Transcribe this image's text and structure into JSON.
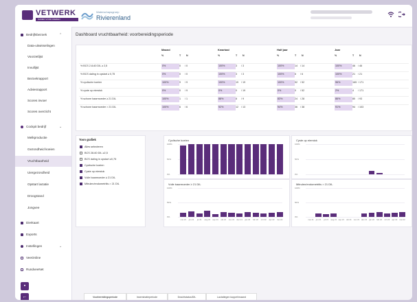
{
  "header": {
    "logo_text": "VETWERK",
    "logo_sub": "SAMEN VOOR DIEREN",
    "partner_small": "Waterschapsgroep",
    "partner_big": "Rivierenland",
    "wifi_icon": "wifi-icon",
    "logout_icon": "logout-icon"
  },
  "sidebar": {
    "items": [
      {
        "label": "Bedrijfsbezoek",
        "chevron": "⌃"
      },
      {
        "label": "Data-uitwisselingen"
      },
      {
        "label": "Voorzetlijst"
      },
      {
        "label": "Invullijst"
      },
      {
        "label": "Bezoekrapport"
      },
      {
        "label": "Adviesrapport"
      },
      {
        "label": "Scores invoer"
      },
      {
        "label": "Scores overzicht"
      },
      {
        "label": "Cockpit bedrijf",
        "chevron": "⌄"
      },
      {
        "label": "Melkproductie"
      },
      {
        "label": "Gezondheid koeien"
      },
      {
        "label": "Vruchtbaarheid"
      },
      {
        "label": "Uiergezondheid"
      },
      {
        "label": "Opstart lactatie"
      },
      {
        "label": "Droogstand"
      },
      {
        "label": "Jongvee"
      },
      {
        "label": "Dierkaart"
      },
      {
        "label": "Exports"
      },
      {
        "label": "Instellingen",
        "chevron": "⌄"
      },
      {
        "label": "VeeOnline"
      },
      {
        "label": "RundveeNet"
      }
    ]
  },
  "main": {
    "title": "Dashboard vruchtbaarheid: voorbereidingsperiode",
    "groups": [
      "Maand",
      "Kwartaal",
      "Half jaar",
      "Jaar"
    ],
    "col_headers": [
      "%",
      "T",
      "N"
    ],
    "rows": [
      {
        "label": "% BCS 2.8-60 DIL ≥ 2,5",
        "cells": [
          [
            "0%",
            "0",
            "/ 0"
          ],
          [
            "100%",
            "3",
            "/ 3"
          ],
          [
            "100%",
            "14",
            "/ 14"
          ],
          [
            "100%",
            "46",
            "/ 46"
          ]
        ]
      },
      {
        "label": "% BCS daling in opstart ≥ 0,75",
        "cells": [
          [
            "0%",
            "0",
            "/ 0"
          ],
          [
            "100%",
            "3",
            "/ 3"
          ],
          [
            "100%",
            "6",
            "/ 6"
          ],
          [
            "100%",
            "21",
            "/ 21"
          ]
        ]
      },
      {
        "label": "% cyclische koeien",
        "cells": [
          [
            "100%",
            "9",
            "/ 9"
          ],
          [
            "100%",
            "19",
            "/ 19"
          ],
          [
            "100%",
            "52",
            "/ 52"
          ],
          [
            "96%",
            "165",
            "/ 171"
          ]
        ]
      },
      {
        "label": "% cyste op eierstok",
        "cells": [
          [
            "0%",
            "0",
            "/ 9"
          ],
          [
            "0%",
            "0",
            "/ 19"
          ],
          [
            "0%",
            "0",
            "/ 52"
          ],
          [
            "2%",
            "4",
            "/ 171"
          ]
        ]
      },
      {
        "label": "% schone baarmoeder ≥ 21 DIL",
        "cells": [
          [
            "100%",
            "1",
            "/ 1"
          ],
          [
            "88%",
            "8",
            "/ 9"
          ],
          [
            "83%",
            "24",
            "/ 28"
          ],
          [
            "86%",
            "80",
            "/ 93"
          ]
        ]
      },
      {
        "label": "% schone baarmoeder > 21 DIL",
        "cells": [
          [
            "100%",
            "6",
            "/ 6"
          ],
          [
            "92%",
            "12",
            "/ 13"
          ],
          [
            "94%",
            "36",
            "/ 38"
          ],
          [
            "91%",
            "94",
            "/ 103"
          ]
        ]
      }
    ]
  },
  "toon": {
    "title": "Toon grafiek",
    "options": [
      {
        "label": "Alles selecteren",
        "checked": true
      },
      {
        "label": "BCS 28-60 DIL ≥2,5",
        "checked": false
      },
      {
        "label": "BCS daling in opstart ≥0,75",
        "checked": false
      },
      {
        "label": "Cyclische koeien",
        "checked": true
      },
      {
        "label": "Cyste op eierstok",
        "checked": true
      },
      {
        "label": "Vuile baarmoeder ≥ 21 DIL",
        "checked": true
      },
      {
        "label": "Mitrulen/endometritis > 21 DIL",
        "checked": true
      }
    ]
  },
  "charts": {
    "months": [
      "mei 21",
      "jun 21",
      "jul 21",
      "aug 21",
      "sep 21",
      "okt 21",
      "nov 21",
      "dec 21",
      "jan 22",
      "feb 22",
      "mrt 22",
      "apr 22",
      "mei 22"
    ],
    "yticks": [
      "100%",
      "50%",
      "0%"
    ],
    "c1": {
      "title": "Cyclische koeien",
      "values": [
        96,
        100,
        100,
        100,
        100,
        100,
        100,
        100,
        100,
        100,
        100,
        100,
        100
      ]
    },
    "c2": {
      "title": "Cyste op eierstok",
      "values": [
        0,
        0,
        0,
        0,
        0,
        0,
        0,
        0,
        12,
        4,
        0,
        0,
        0
      ]
    },
    "c3": {
      "title": "Vuile baarmoeder ≥ 21 DIL",
      "values": [
        14,
        20,
        12,
        22,
        10,
        16,
        14,
        12,
        16,
        14,
        12,
        14,
        16
      ]
    },
    "c4": {
      "title": "Mitrulen/endometritis > 21 DIL",
      "values": [
        0,
        12,
        10,
        12,
        0,
        0,
        0,
        12,
        14,
        16,
        12,
        14,
        16
      ]
    }
  },
  "tabs": [
    "Voorbereidingsperiode",
    "Inseminatieperiode",
    "Drachtstatus/DIL",
    "Lactatiegen koppel/maand"
  ]
}
